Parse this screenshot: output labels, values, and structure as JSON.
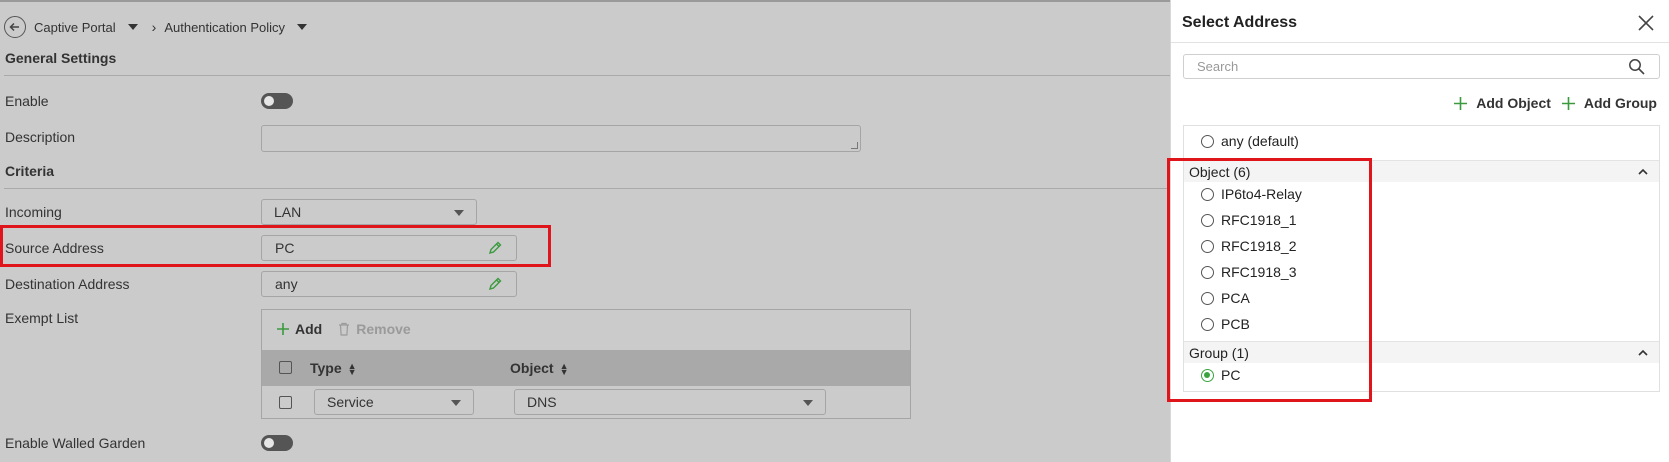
{
  "breadcrumb": {
    "item1": "Captive Portal",
    "item2": "Authentication Policy"
  },
  "general": {
    "title": "General Settings",
    "enable_label": "Enable",
    "description_label": "Description"
  },
  "criteria": {
    "title": "Criteria",
    "incoming_label": "Incoming",
    "incoming_value": "LAN",
    "source_label": "Source Address",
    "source_value": "PC",
    "destination_label": "Destination Address",
    "destination_value": "any",
    "exempt_label": "Exempt List",
    "walled_garden_label": "Enable Walled Garden"
  },
  "exempt_list": {
    "add_label": "Add",
    "remove_label": "Remove",
    "col_type": "Type",
    "col_object": "Object",
    "rows": [
      {
        "type": "Service",
        "object": "DNS"
      }
    ]
  },
  "panel": {
    "title": "Select Address",
    "search_placeholder": "Search",
    "add_object_label": "Add Object",
    "add_group_label": "Add Group",
    "default_option": "any (default)",
    "object_group_label": "Object (6)",
    "objects": [
      "IP6to4-Relay",
      "RFC1918_1",
      "RFC1918_2",
      "RFC1918_3",
      "PCA",
      "PCB"
    ],
    "group_group_label": "Group (1)",
    "groups": [
      "PC"
    ],
    "selected": "PC"
  },
  "colors": {
    "accent_green": "#39a43f",
    "highlight_red": "#e0141b",
    "overlay_gray": "#cbcbcb"
  }
}
